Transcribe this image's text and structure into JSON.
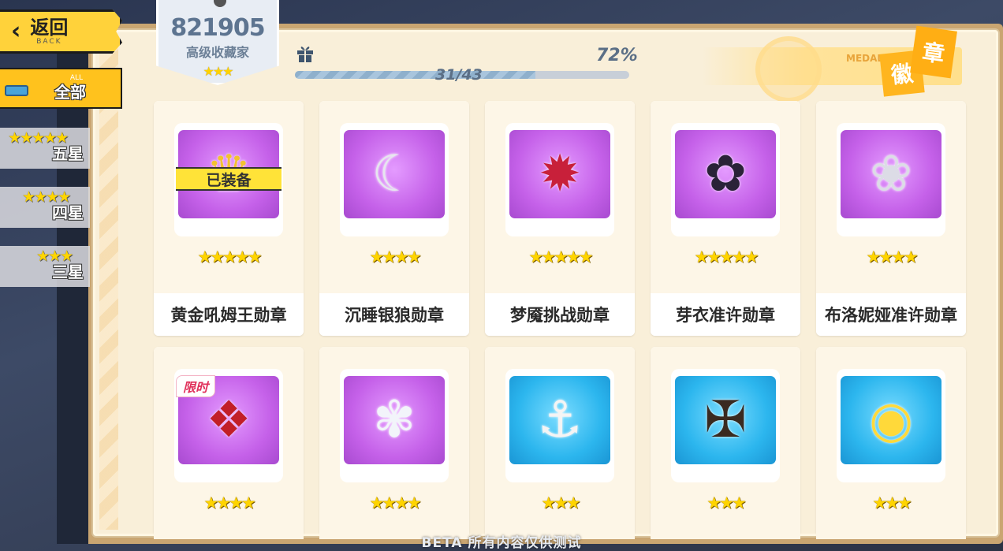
{
  "nav": {
    "back_label": "返回",
    "back_sub": "BACK"
  },
  "filters": [
    {
      "sub": "ALL",
      "label": "全部",
      "stars": "",
      "active": true
    },
    {
      "sub": "",
      "label": "五星",
      "stars": "★★★★★",
      "active": false
    },
    {
      "sub": "",
      "label": "四星",
      "stars": "★★★★",
      "active": false
    },
    {
      "sub": "",
      "label": "三星",
      "stars": "★★★",
      "active": false
    }
  ],
  "collector": {
    "score": "821905",
    "title": "高级收藏家",
    "stars": "★★★"
  },
  "progress": {
    "percent_label": "72%",
    "count_label": "31/43",
    "fraction": 0.72
  },
  "header": {
    "medal_en": "MEDAL",
    "medal_char1": "章",
    "medal_char2": "徽"
  },
  "medals": [
    {
      "name": "黄金吼姆王勋章",
      "stars": "★★★★★",
      "color": "purple",
      "equipped": "已装备",
      "limited": "",
      "icon": "gold-homu-king-medal-icon"
    },
    {
      "name": "沉睡银狼勋章",
      "stars": "★★★★",
      "color": "purple",
      "equipped": "",
      "limited": "",
      "icon": "sleeping-silver-wolf-medal-icon"
    },
    {
      "name": "梦魇挑战勋章",
      "stars": "★★★★★",
      "color": "purple",
      "equipped": "",
      "limited": "",
      "icon": "nightmare-challenge-medal-icon"
    },
    {
      "name": "芽衣准许勋章",
      "stars": "★★★★★",
      "color": "purple",
      "equipped": "",
      "limited": "",
      "icon": "mei-permit-medal-icon"
    },
    {
      "name": "布洛妮娅准许勋章",
      "stars": "★★★★",
      "color": "purple",
      "equipped": "",
      "limited": "",
      "icon": "bronya-permit-medal-icon"
    },
    {
      "name": "",
      "stars": "★★★★",
      "color": "purple",
      "equipped": "",
      "limited": "限时",
      "icon": "red-lotus-medal-icon"
    },
    {
      "name": "",
      "stars": "★★★★",
      "color": "purple",
      "equipped": "",
      "limited": "",
      "icon": "white-hair-girl-medal-icon"
    },
    {
      "name": "",
      "stars": "★★★",
      "color": "blue",
      "equipped": "",
      "limited": "",
      "icon": "captain-anchor-medal-icon"
    },
    {
      "name": "",
      "stars": "★★★",
      "color": "blue",
      "equipped": "",
      "limited": "",
      "icon": "cross-book-medal-icon"
    },
    {
      "name": "",
      "stars": "★★★",
      "color": "blue",
      "equipped": "",
      "limited": "",
      "icon": "yellow-bird-medal-icon"
    }
  ],
  "footer": {
    "beta_text": "BETA 所有内容仅供测试"
  }
}
